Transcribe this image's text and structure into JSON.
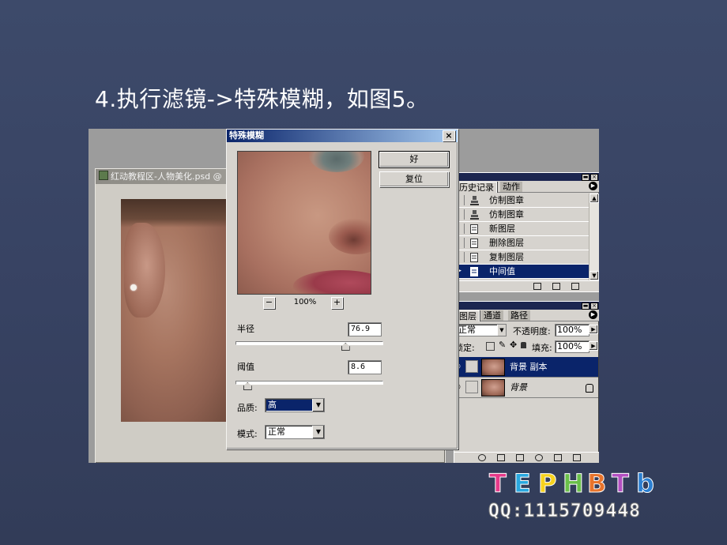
{
  "slide_title": "4.执行滤镜->特殊模糊，如图5。",
  "document_window": {
    "title": "红动教程区-人物美化.psd @"
  },
  "dialog": {
    "title": "特殊模糊",
    "close": "×",
    "ok_label": "好",
    "reset_label": "复位",
    "zoom_minus": "−",
    "zoom_plus": "+",
    "zoom_value": "100%",
    "radius_label": "半径",
    "radius_value": "76.9",
    "radius_position": 0.75,
    "threshold_label": "阈值",
    "threshold_value": "8.6",
    "threshold_position": 0.08,
    "quality_label": "品质:",
    "quality_value": "高",
    "mode_label": "模式:",
    "mode_value": "正常"
  },
  "history_panel": {
    "tabs": [
      "历史记录",
      "动作"
    ],
    "items": [
      {
        "label": "仿制图章",
        "icon": "stamp-icon",
        "selected": false
      },
      {
        "label": "仿制图章",
        "icon": "stamp-icon",
        "selected": false
      },
      {
        "label": "新图层",
        "icon": "document-icon",
        "selected": false
      },
      {
        "label": "删除图层",
        "icon": "document-icon",
        "selected": false
      },
      {
        "label": "复制图层",
        "icon": "document-icon",
        "selected": false
      },
      {
        "label": "中间值",
        "icon": "document-icon",
        "selected": true
      }
    ]
  },
  "layers_panel": {
    "tabs": [
      "图层",
      "通道",
      "路径"
    ],
    "blend_mode": "正常",
    "opacity_label": "不透明度:",
    "opacity_value": "100%",
    "lock_label": "锁定:",
    "fill_label": "填充:",
    "fill_value": "100%",
    "layers": [
      {
        "name": "背景 副本",
        "selected": true
      },
      {
        "name": "背景",
        "selected": false
      }
    ]
  },
  "watermark": {
    "logo_text": "TEPHBTb",
    "qq_text": "QQ:1115709448",
    "logo_colors": [
      "#e63a8a",
      "#29a8e0",
      "#f6d21e",
      "#6ac04a",
      "#e8742c",
      "#b34fc1",
      "#2b7fd1"
    ]
  },
  "colors": {
    "slide_bg": "#374262",
    "selection": "#0a246a",
    "window_gray": "#d6d3ce"
  }
}
